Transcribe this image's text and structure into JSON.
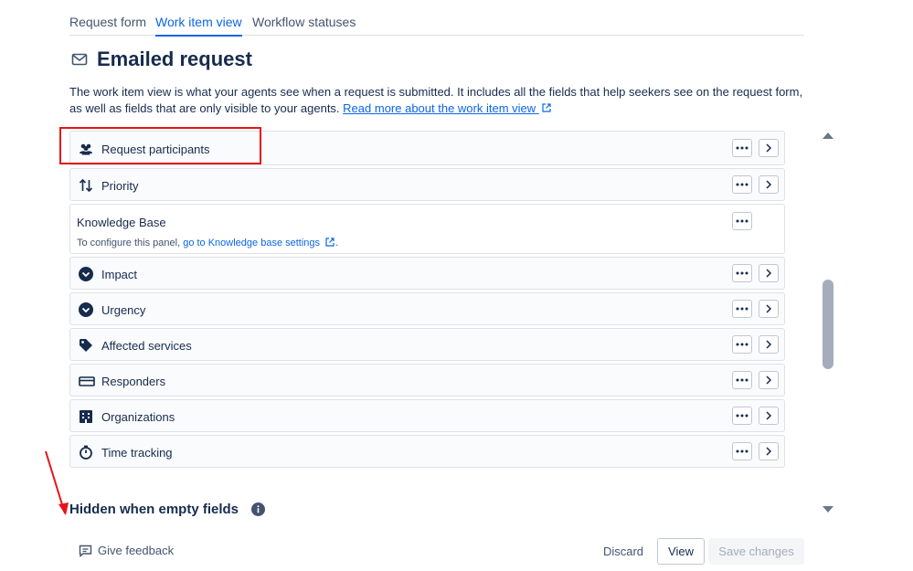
{
  "tabs": [
    {
      "label": "Request form"
    },
    {
      "label": "Work item view"
    },
    {
      "label": "Workflow statuses"
    }
  ],
  "active_tab": "Work item view",
  "header": {
    "title": "Emailed request",
    "icon": "mail-icon"
  },
  "description": {
    "text": "The work item view is what your agents see when a request is submitted. It includes all the fields that help seekers see on the request form, as well as fields that are only visible to your agents.",
    "link": "Read more about the work item view"
  },
  "fields": [
    {
      "label": "Request participants",
      "icon": "people-icon"
    },
    {
      "label": "Priority",
      "icon": "priority-arrows-icon"
    },
    {
      "label": "Knowledge Base",
      "sub_text": "To configure this panel,",
      "sub_link": "go to Knowledge base settings",
      "sub_end": "."
    },
    {
      "label": "Impact",
      "icon": "chevron-circle-icon"
    },
    {
      "label": "Urgency",
      "icon": "chevron-circle-icon"
    },
    {
      "label": "Affected services",
      "icon": "tag-icon"
    },
    {
      "label": "Responders",
      "icon": "responders-icon"
    },
    {
      "label": "Organizations",
      "icon": "building-icon"
    },
    {
      "label": "Time tracking",
      "icon": "stopwatch-icon"
    }
  ],
  "hidden_section": {
    "title": "Hidden when empty fields"
  },
  "footer": {
    "feedback": "Give feedback",
    "discard": "Discard",
    "view": "View",
    "save": "Save changes"
  },
  "colors": {
    "accent": "#0c66e4",
    "annotation": "#e5141b"
  }
}
